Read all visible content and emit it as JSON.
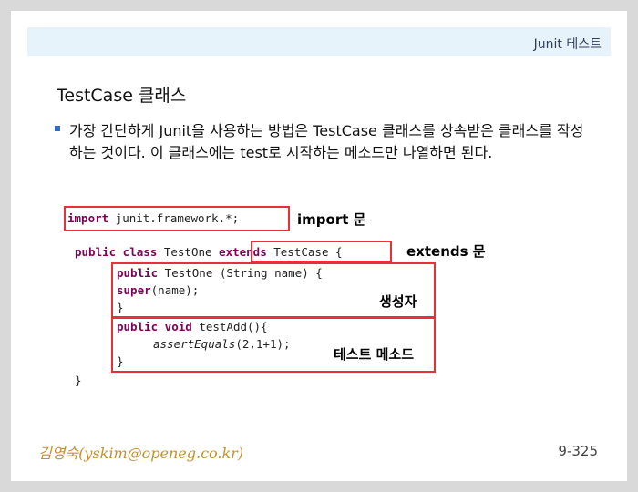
{
  "header": {
    "title": "Junit 테스트"
  },
  "slide": {
    "title": "TestCase 클래스",
    "bullet": "가장 간단하게 Junit을 사용하는 방법은 TestCase 클래스를 상속받은 클래스를 작성하는 것이다. 이 클래스에는 test로 시작하는 메소드만 나열하면 된다."
  },
  "code": {
    "import_kw": "import",
    "import_rest": " junit.framework.*;",
    "class_public": "public",
    "class_kw": " class",
    "class_name": " TestOne ",
    "extends_kw": "extends",
    "extends_rest": " TestCase",
    "class_brace": " {",
    "ctor_public": "public",
    "ctor_rest": " TestOne (String name) {",
    "super_kw": "super",
    "super_rest": "(name);",
    "ctor_close": "}",
    "method_public": "public",
    "method_void": " void",
    "method_rest": " testAdd(){",
    "assert_call": "assertEquals",
    "assert_args": "(2,1+1);",
    "method_close": "}",
    "class_close": "}"
  },
  "annotations": {
    "import": "import 문",
    "extends": "extends 문",
    "constructor": "생성자",
    "test_method": "테스트 메소드"
  },
  "footer": {
    "author": "김영숙(yskim@openeg.co.kr)",
    "page": "9-325"
  },
  "colors": {
    "highlight_box": "#e8303a",
    "keyword": "#7f0055",
    "header_bar": "#e6f3fb",
    "bullet": "#3366cc"
  }
}
